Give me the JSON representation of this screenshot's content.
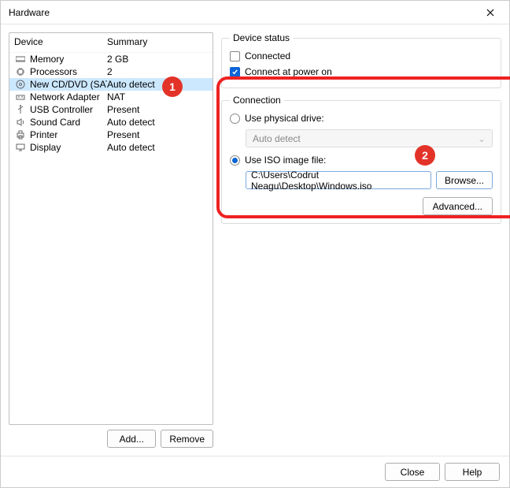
{
  "window": {
    "title": "Hardware"
  },
  "list": {
    "header_device": "Device",
    "header_summary": "Summary",
    "rows": [
      {
        "label": "Memory",
        "summary": "2 GB"
      },
      {
        "label": "Processors",
        "summary": "2"
      },
      {
        "label": "New CD/DVD (SATA)",
        "summary": "Auto detect"
      },
      {
        "label": "Network Adapter",
        "summary": "NAT"
      },
      {
        "label": "USB Controller",
        "summary": "Present"
      },
      {
        "label": "Sound Card",
        "summary": "Auto detect"
      },
      {
        "label": "Printer",
        "summary": "Present"
      },
      {
        "label": "Display",
        "summary": "Auto detect"
      }
    ],
    "add": "Add...",
    "remove": "Remove"
  },
  "status": {
    "legend": "Device status",
    "connected": "Connected",
    "poweron": "Connect at power on"
  },
  "connection": {
    "legend": "Connection",
    "physical": "Use physical drive:",
    "drive_value": "Auto detect",
    "use_iso": "Use ISO image file:",
    "iso_path": "C:\\Users\\Codrut Neagu\\Desktop\\Windows.iso",
    "browse": "Browse...",
    "advanced": "Advanced..."
  },
  "bottom": {
    "close": "Close",
    "help": "Help"
  },
  "callouts": {
    "one": "1",
    "two": "2"
  }
}
